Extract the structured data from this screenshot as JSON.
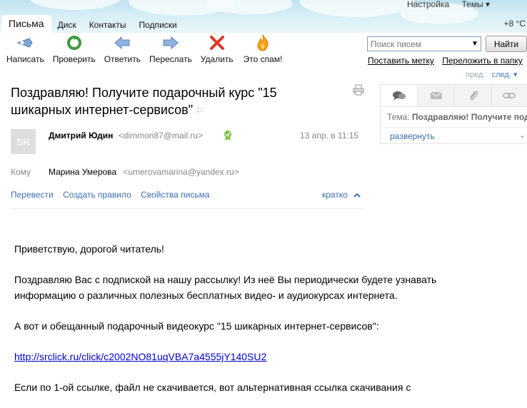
{
  "header": {
    "settings_link": "Настройка",
    "themes_link": "Темы ▾",
    "weather": "+8 °C",
    "tabs": [
      {
        "label": "Письма"
      },
      {
        "label": "Диск"
      },
      {
        "label": "Контакты"
      },
      {
        "label": "Подписки"
      }
    ]
  },
  "toolbar": {
    "buttons": [
      {
        "label": "Написать",
        "icon": "compose-icon"
      },
      {
        "label": "Проверить",
        "icon": "refresh-icon"
      },
      {
        "label": "Ответить",
        "icon": "reply-icon"
      },
      {
        "label": "Переслать",
        "icon": "forward-icon"
      },
      {
        "label": "Удалить",
        "icon": "delete-icon"
      },
      {
        "label": "Это спам!",
        "icon": "spam-icon"
      }
    ]
  },
  "search": {
    "placeholder": "Поиск писем",
    "button_label": "Найти",
    "links": [
      "Поставить метку",
      "Переложить в папку"
    ]
  },
  "pager": {
    "prev": "пред.",
    "next": "след."
  },
  "side_panel": {
    "subject_label": "Тема:",
    "subject_value": "Поздравляю! Получите подарочный курс",
    "expand_label": "развернуть"
  },
  "message": {
    "subject": "Поздравляю! Получите подарочный курс \"15 шикарных интернет-сервисов\"",
    "avatar_initials": "SR",
    "sender_name": "Дмитрий Юдин",
    "sender_email": "<dimmon87@mail.ru>",
    "date": "13 апр. в 11:15",
    "to_label": "Кому",
    "to_name": "Марина Умерова",
    "to_email": "<umerovamarina@yandex.ru>",
    "actions": [
      "Перевести",
      "Создать правило",
      "Свойства письма"
    ],
    "brief_label": "кратко",
    "body": {
      "p1": "Приветствую, дорогой читатель!",
      "p2": "Поздравляю Вас с подпиской на нашу рассылку! Из неё Вы периодически будете узнавать информацию о различных полезных бесплатных видео- и аудиокурсах интернета.",
      "p3": "А вот и обещанный подарочный видеокурс \"15 шикарных интернет-сервисов\":",
      "link": "http://srclick.ru/click/c2002NO81uqVBA7a4555jY140SU2",
      "p4": "Если по 1-ой ссылке, файл не скачивается, вот альтернативная ссылка скачивания с"
    }
  }
}
